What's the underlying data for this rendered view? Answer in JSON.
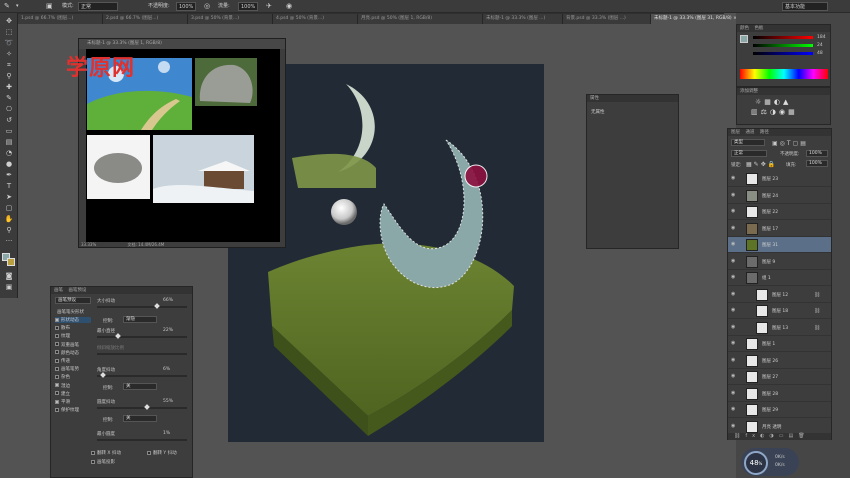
{
  "options_bar": {
    "mode_label": "模式:",
    "mode_value": "正常",
    "opacity_label": "不透明度:",
    "opacity_value": "100%",
    "flow_label": "流量:",
    "flow_value": "100%",
    "workspace": "基本功能"
  },
  "tabs": [
    {
      "label": "1.psd @ 66.7% (图层...)",
      "active": false
    },
    {
      "label": "2.psd @ 66.7% (图层...)",
      "active": false
    },
    {
      "label": "3.psd @ 50% (背景...)",
      "active": false
    },
    {
      "label": "4.psd @ 50% (背景...)",
      "active": false
    },
    {
      "label": "月亮.psd @ 50% (图层 1, RGB/8)",
      "active": false
    },
    {
      "label": "未标题-1 @ 33.3% (图层 ...)",
      "active": false
    },
    {
      "label": "背景.psd @ 33.3% (图层 ...)",
      "active": false
    },
    {
      "label": "未标题-1 @ 33.3% (图层 31, RGB/8) ×",
      "active": true
    }
  ],
  "doc_window": {
    "title": "未标题-1 @ 33.3% (图层 1, RGB/8)",
    "zoom": "33.33%",
    "doc_info": "文档: 14.4M/26.4M"
  },
  "watermark": "学原网",
  "brush_panel": {
    "tabs": [
      "画笔",
      "画笔预设"
    ],
    "preset_button": "画笔预设",
    "section_title": "画笔笔尖形状",
    "options": [
      {
        "label": "形状动态",
        "checked": true,
        "active": true
      },
      {
        "label": "散布",
        "checked": false
      },
      {
        "label": "纹理",
        "checked": false
      },
      {
        "label": "双重画笔",
        "checked": false
      },
      {
        "label": "颜色动态",
        "checked": false
      },
      {
        "label": "传递",
        "checked": false
      },
      {
        "label": "画笔笔势",
        "checked": false
      },
      {
        "label": "杂色",
        "checked": false
      },
      {
        "label": "湿边",
        "checked": true
      },
      {
        "label": "建立",
        "checked": false
      },
      {
        "label": "平滑",
        "checked": true
      },
      {
        "label": "保护纹理",
        "checked": false
      }
    ],
    "size_jitter_label": "大小抖动",
    "size_jitter_value": "66%",
    "control_label": "控制:",
    "control_value": "渐隐",
    "min_diameter_label": "最小直径",
    "min_diameter_value": "22%",
    "tilt_scale_label": "倾斜缩放比例",
    "angle_jitter_label": "角度抖动",
    "angle_jitter_value": "6%",
    "control2_value": "关",
    "roundness_jitter_label": "圆度抖动",
    "roundness_jitter_value": "55%",
    "control3_value": "关",
    "min_roundness_label": "最小圆度",
    "min_roundness_value": "1%",
    "flip_x_label": "翻转 X 抖动",
    "flip_y_label": "翻转 Y 抖动",
    "brush_projection_label": "画笔投影"
  },
  "properties_panel": {
    "title": "属性",
    "content": "无属性"
  },
  "color_panel": {
    "tabs": [
      "颜色",
      "色板"
    ],
    "r_value": "184",
    "g_value": "24",
    "b_value": "48"
  },
  "adjust_panel": {
    "title": "添加调整"
  },
  "layers_panel": {
    "tabs": [
      "图层",
      "通道",
      "路径"
    ],
    "kind_label": "类型",
    "blend_mode": "正常",
    "opacity_label": "不透明度:",
    "opacity_value": "100%",
    "lock_label": "锁定:",
    "fill_label": "填充:",
    "fill_value": "100%",
    "layers": [
      {
        "name": "图层 23",
        "visible": true,
        "selected": false,
        "thumb": "light"
      },
      {
        "name": "图层 24",
        "visible": true,
        "selected": false,
        "thumb": "rock"
      },
      {
        "name": "图层 22",
        "visible": true,
        "selected": false,
        "thumb": "light"
      },
      {
        "name": "图层 17",
        "visible": true,
        "selected": false,
        "thumb": "photo"
      },
      {
        "name": "图层 31",
        "visible": true,
        "selected": true,
        "thumb": "green"
      },
      {
        "name": "图层 9",
        "visible": true,
        "selected": false,
        "thumb": "folder"
      },
      {
        "name": "组 1",
        "visible": true,
        "selected": false,
        "thumb": "folder"
      },
      {
        "name": "图层 12",
        "visible": true,
        "selected": false,
        "thumb": "light"
      },
      {
        "name": "图层 18",
        "visible": true,
        "selected": false,
        "thumb": "light"
      },
      {
        "name": "图层 13",
        "visible": true,
        "selected": false,
        "thumb": "light"
      },
      {
        "name": "图层 1",
        "visible": true,
        "selected": false,
        "thumb": "light"
      },
      {
        "name": "图层 26",
        "visible": true,
        "selected": false,
        "thumb": "light"
      },
      {
        "name": "图层 27",
        "visible": true,
        "selected": false,
        "thumb": "light"
      },
      {
        "name": "图层 28",
        "visible": true,
        "selected": false,
        "thumb": "light"
      },
      {
        "name": "图层 29",
        "visible": true,
        "selected": false,
        "thumb": "light"
      },
      {
        "name": "月亮 透明",
        "visible": true,
        "selected": false,
        "thumb": "light"
      }
    ]
  },
  "navigator_widget": {
    "value": "48",
    "unit": "%",
    "up_speed": "0K/s",
    "down_speed": "0K/s"
  },
  "colors": {
    "canvas_bg": "#222a35",
    "grass": "#5d7326",
    "moon": "#8aa8a8",
    "accent_red": "#e0312e"
  }
}
